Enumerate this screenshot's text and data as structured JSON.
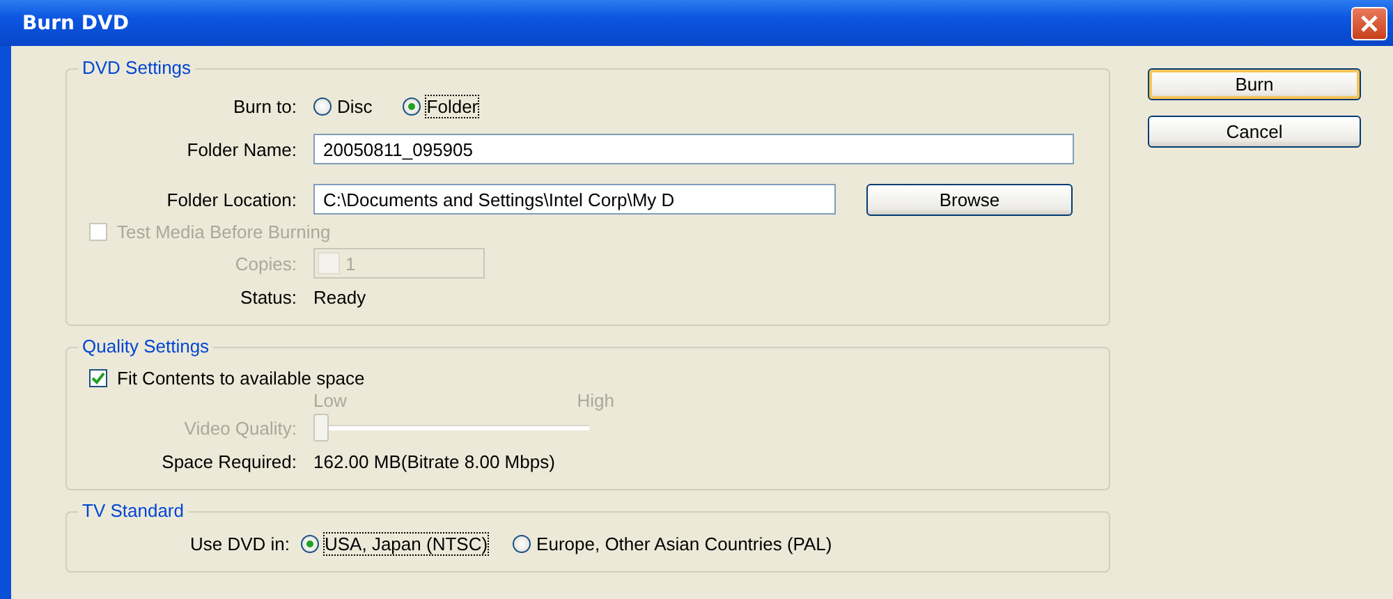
{
  "window": {
    "title": "Burn DVD"
  },
  "dvd_settings": {
    "title": "DVD Settings",
    "burn_to": {
      "label": "Burn to:",
      "options": [
        {
          "label": "Disc",
          "selected": false
        },
        {
          "label": "Folder",
          "selected": true
        }
      ]
    },
    "folder_name": {
      "label": "Folder Name:",
      "value": "20050811_095905"
    },
    "folder_location": {
      "label": "Folder Location:",
      "value": "C:\\Documents and Settings\\Intel Corp\\My D"
    },
    "browse_button": "Browse",
    "test_media": {
      "label": "Test Media Before Burning",
      "checked": false,
      "disabled": true
    },
    "copies": {
      "label": "Copies:",
      "value": "1",
      "disabled": true
    },
    "status": {
      "label": "Status:",
      "value": "Ready"
    }
  },
  "quality_settings": {
    "title": "Quality Settings",
    "fit_contents": {
      "label": "Fit Contents to available space",
      "checked": true,
      "disabled": false
    },
    "video_quality": {
      "label": "Video Quality:",
      "low": "Low",
      "high": "High",
      "level": 0,
      "disabled": true
    },
    "space_required": {
      "label": "Space Required:",
      "value": "162.00 MB(Bitrate 8.00 Mbps)"
    }
  },
  "tv_standard": {
    "title": "TV Standard",
    "use_dvd_in": {
      "label": "Use DVD in:",
      "options": [
        {
          "label": "USA, Japan (NTSC)",
          "selected": true
        },
        {
          "label": "Europe, Other Asian Countries (PAL)",
          "selected": false
        }
      ]
    }
  },
  "buttons": [
    {
      "label": "Burn",
      "default": true
    },
    {
      "label": "Cancel",
      "default": false
    }
  ]
}
